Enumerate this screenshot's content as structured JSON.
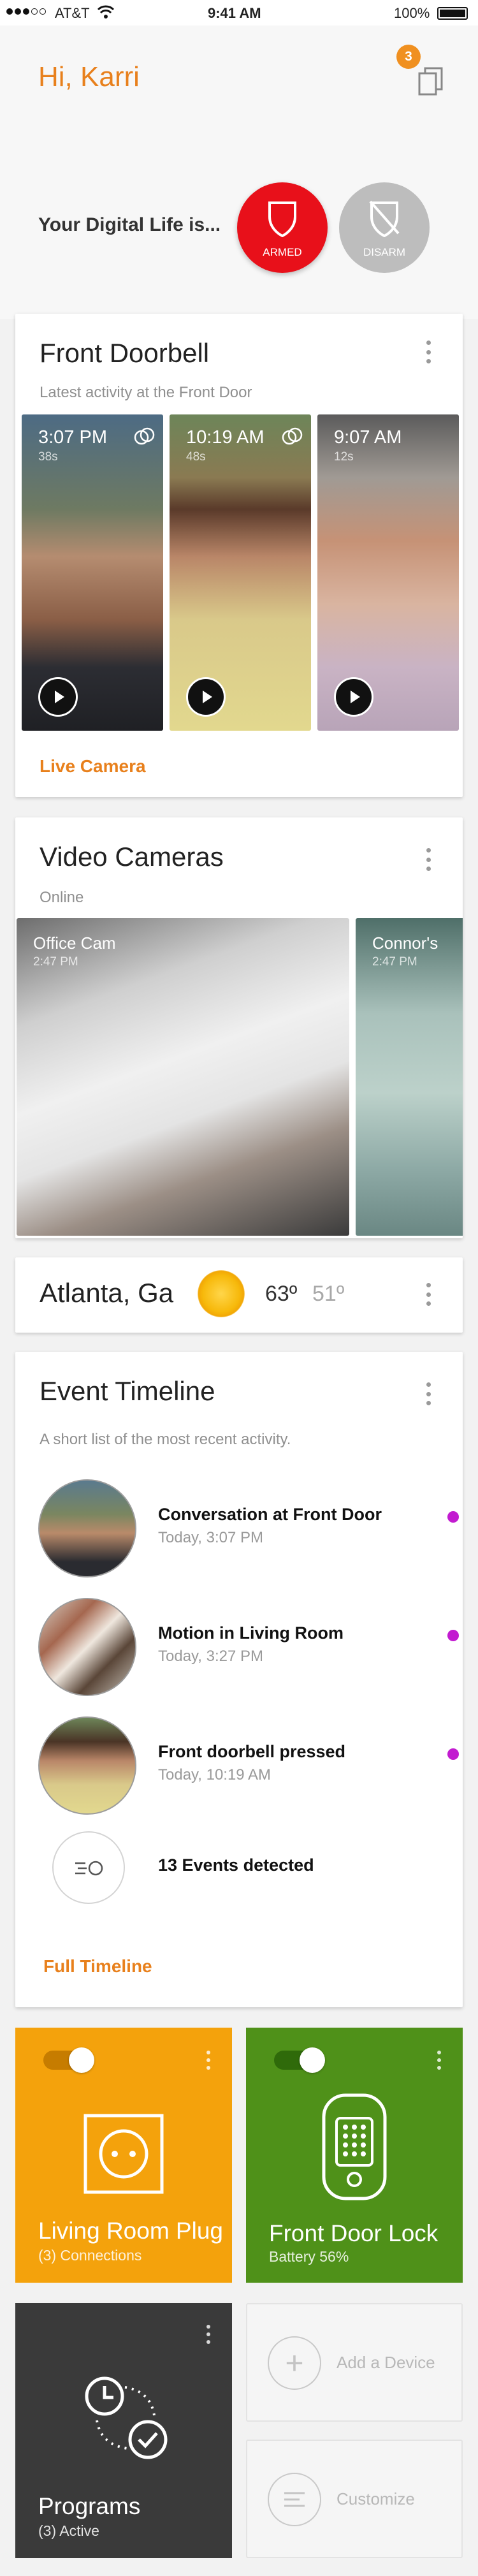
{
  "status_bar": {
    "carrier": "AT&T",
    "time": "9:41 AM",
    "battery": "100%"
  },
  "header": {
    "greeting": "Hi, Karri",
    "notification_count": "3"
  },
  "security": {
    "label": "Your Digital Life is...",
    "armed_label": "ARMED",
    "disarm_label": "DISARM"
  },
  "doorbell": {
    "title": "Front Doorbell",
    "subtitle": "Latest activity at the Front Door",
    "clips": [
      {
        "time": "3:07 PM",
        "duration": "38s"
      },
      {
        "time": "10:19 AM",
        "duration": "48s"
      },
      {
        "time": "9:07 AM",
        "duration": "12s"
      }
    ],
    "link": "Live Camera"
  },
  "cameras": {
    "title": "Video Cameras",
    "subtitle": "Online",
    "items": [
      {
        "name": "Office Cam",
        "time": "2:47 PM"
      },
      {
        "name": "Connor's",
        "time": "2:47 PM"
      }
    ]
  },
  "weather": {
    "city": "Atlanta, Ga",
    "high": "63º",
    "low": "51º"
  },
  "timeline": {
    "title": "Event Timeline",
    "subtitle": "A short list of the most recent activity.",
    "events": [
      {
        "title": "Conversation at Front Door",
        "time": "Today, 3:07 PM"
      },
      {
        "title": "Motion in Living Room",
        "time": "Today, 3:27 PM"
      },
      {
        "title": "Front doorbell pressed",
        "time": "Today, 10:19 AM"
      }
    ],
    "summary": "13 Events detected",
    "link": "Full Timeline"
  },
  "tiles": {
    "plug": {
      "title": "Living Room Plug",
      "sub": "(3) Connections",
      "color": "#f4a20c"
    },
    "lock": {
      "title": "Front Door Lock",
      "sub": "Battery 56%",
      "color": "#4f9119"
    },
    "programs": {
      "title": "Programs",
      "sub": "(3) Active",
      "color": "#3a3a3a"
    },
    "add_device": "Add a Device",
    "customize": "Customize"
  },
  "colors": {
    "accent": "#e8801c",
    "armed": "#e8101a",
    "disarm": "#bdbdbd",
    "event_dot": "#c21bd0"
  }
}
